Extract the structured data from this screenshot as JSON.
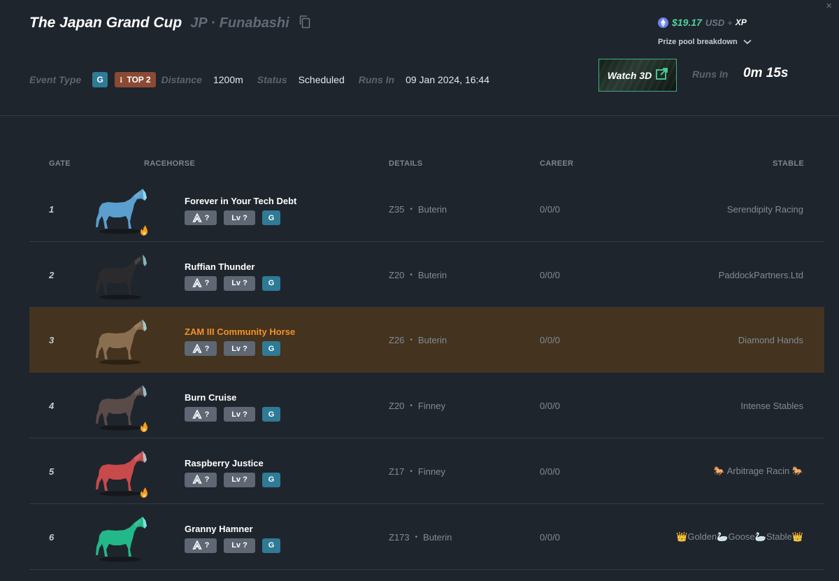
{
  "header": {
    "title": "The Japan Grand Cup",
    "location": "JP · Funabashi",
    "close_glyph": "×",
    "prize": {
      "amount": "$19.17",
      "currency": "USD",
      "plus": "+",
      "xp": "XP",
      "breakdown_label": "Prize pool breakdown"
    },
    "info": {
      "event_type_label": "Event Type",
      "event_type_badge": "G",
      "top_badge": "TOP 2",
      "distance_label": "Distance",
      "distance_value": "1200m",
      "status_label": "Status",
      "status_value": "Scheduled",
      "runs_in_label": "Runs In",
      "runs_in_value": "09 Jan 2024, 16:44"
    },
    "watch_label": "Watch 3D",
    "countdown_label": "Runs In",
    "countdown_value": "0m 15s"
  },
  "table": {
    "headers": {
      "gate": "GATE",
      "racehorse": "RACEHORSE",
      "details": "DETAILS",
      "career": "CAREER",
      "stable": "STABLE"
    },
    "rows": [
      {
        "gate": "1",
        "name": "Forever in Your Tech Debt",
        "chip_a": "?",
        "chip_lv": "Lv ?",
        "chip_g": "G",
        "zed": "Z35",
        "bloodline": "Buterin",
        "career": "0/0/0",
        "stable": "Serendipity Racing",
        "color": "#5a9fd0",
        "fire": true,
        "highlight": false
      },
      {
        "gate": "2",
        "name": "Ruffian Thunder",
        "chip_a": "?",
        "chip_lv": "Lv ?",
        "chip_g": "G",
        "zed": "Z20",
        "bloodline": "Buterin",
        "career": "0/0/0",
        "stable": "PaddockPartners.Ltd",
        "color": "#2b2b2d",
        "fire": false,
        "highlight": false
      },
      {
        "gate": "3",
        "name": "ZAM III Community Horse",
        "chip_a": "?",
        "chip_lv": "Lv ?",
        "chip_g": "G",
        "zed": "Z26",
        "bloodline": "Buterin",
        "career": "0/0/0",
        "stable": "Diamond Hands",
        "color": "#8a6e50",
        "fire": false,
        "highlight": true
      },
      {
        "gate": "4",
        "name": "Burn Cruise",
        "chip_a": "?",
        "chip_lv": "Lv ?",
        "chip_g": "G",
        "zed": "Z20",
        "bloodline": "Finney",
        "career": "0/0/0",
        "stable": "Intense Stables",
        "color": "#5a4a48",
        "fire": true,
        "highlight": false
      },
      {
        "gate": "5",
        "name": "Raspberry Justice",
        "chip_a": "?",
        "chip_lv": "Lv ?",
        "chip_g": "G",
        "zed": "Z17",
        "bloodline": "Finney",
        "career": "0/0/0",
        "stable": "🐎 Arbitrage Racin 🐎",
        "color": "#c84a4a",
        "fire": true,
        "highlight": false
      },
      {
        "gate": "6",
        "name": "Granny Hamner",
        "chip_a": "?",
        "chip_lv": "Lv ?",
        "chip_g": "G",
        "zed": "Z173",
        "bloodline": "Buterin",
        "career": "0/0/0",
        "stable": "👑Golden🦢Goose🦢Stable👑",
        "color": "#22b88a",
        "fire": false,
        "highlight": false
      }
    ]
  },
  "icons": {
    "copy": "copy-icon",
    "eth": "ethereum-icon",
    "chevron": "chevron-down-icon",
    "external": "external-link-icon",
    "fire": "fire-icon",
    "a_chip": "zed-logo-icon"
  }
}
